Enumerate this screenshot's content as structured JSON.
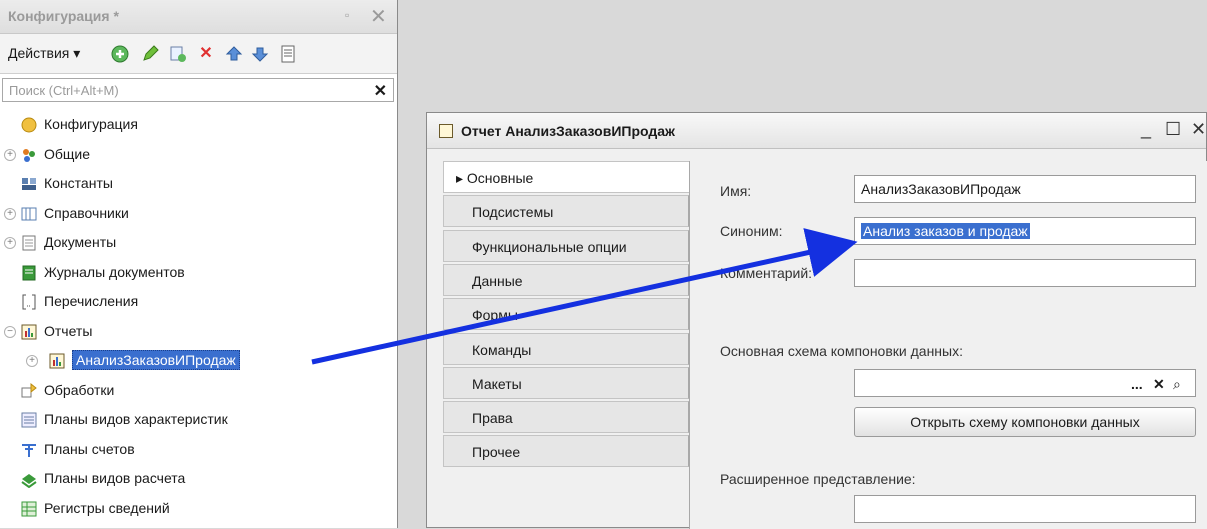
{
  "left_panel": {
    "title": "Конфигурация *",
    "pin": "▫",
    "close": "✕",
    "toolbar": {
      "actions_label": "Действия ▾"
    },
    "search": {
      "placeholder": "Поиск (Ctrl+Alt+M)",
      "clear": "✕"
    },
    "tree": [
      {
        "label": "Конфигурация",
        "icon": "config-icon",
        "expander": "",
        "indent": 0
      },
      {
        "label": "Общие",
        "icon": "common-icon",
        "expander": "+",
        "indent": 0
      },
      {
        "label": "Константы",
        "icon": "constants-icon",
        "expander": "",
        "indent": 0
      },
      {
        "label": "Справочники",
        "icon": "catalogs-icon",
        "expander": "+",
        "indent": 0
      },
      {
        "label": "Документы",
        "icon": "documents-icon",
        "expander": "+",
        "indent": 0
      },
      {
        "label": "Журналы документов",
        "icon": "journals-icon",
        "expander": "",
        "indent": 0
      },
      {
        "label": "Перечисления",
        "icon": "enums-icon",
        "expander": "",
        "indent": 0
      },
      {
        "label": "Отчеты",
        "icon": "reports-icon",
        "expander": "−",
        "indent": 0
      },
      {
        "label": "АнализЗаказовИПродаж",
        "icon": "report-icon",
        "expander": "+",
        "indent": 1,
        "selected": true
      },
      {
        "label": "Обработки",
        "icon": "processing-icon",
        "expander": "",
        "indent": 0
      },
      {
        "label": "Планы видов характеристик",
        "icon": "char-types-icon",
        "expander": "",
        "indent": 0
      },
      {
        "label": "Планы счетов",
        "icon": "accounts-icon",
        "expander": "",
        "indent": 0
      },
      {
        "label": "Планы видов расчета",
        "icon": "calc-types-icon",
        "expander": "",
        "indent": 0
      },
      {
        "label": "Регистры сведений",
        "icon": "info-registers-icon",
        "expander": "",
        "indent": 0
      }
    ]
  },
  "report_window": {
    "title": "Отчет АнализЗаказовИПродаж",
    "minimize": "_",
    "maximize": "☐",
    "close": "✕",
    "tabs": [
      "▸ Основные",
      "Подсистемы",
      "Функциональные опции",
      "Данные",
      "Формы",
      "Команды",
      "Макеты",
      "Права",
      "Прочее"
    ],
    "fields": {
      "name_label": "Имя:",
      "name_value": "АнализЗаказовИПродаж",
      "synonym_label": "Синоним:",
      "synonym_value": "Анализ заказов и продаж",
      "comment_label": "Комментарий:",
      "comment_value": "",
      "schema_label": "Основная схема компоновки данных:",
      "schema_value": "",
      "schema_buttons": [
        "...",
        "✕",
        "⌕"
      ],
      "open_schema_button": "Открыть схему компоновки данных",
      "extended_label": "Расширенное представление:",
      "extended_value": ""
    }
  },
  "colors": {
    "accent": "#3a6fcf",
    "arrow": "#1430e0"
  }
}
